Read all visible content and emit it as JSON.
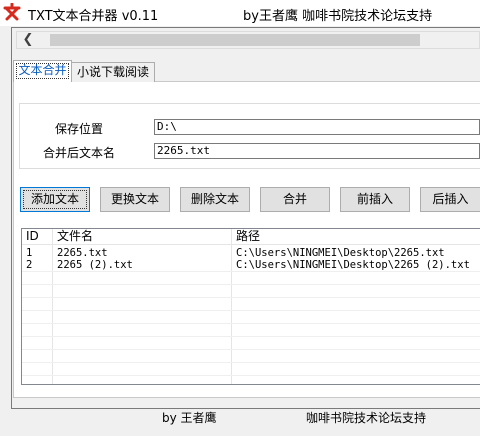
{
  "window": {
    "title": "TXT文本合并器 v0.11",
    "credit": "by王者鹰 咖啡书院技术论坛支持"
  },
  "tabs": [
    {
      "label": "文本合并",
      "active": true
    },
    {
      "label": "小说下载阅读",
      "active": false
    }
  ],
  "form": {
    "save_location_label": "保存位置",
    "save_location_value": "D:\\",
    "merged_name_label": "合并后文本名",
    "merged_name_value": "2265.txt"
  },
  "buttons": {
    "add": "添加文本",
    "replace": "更换文本",
    "delete": "删除文本",
    "merge": "合并",
    "insert_before": "前插入",
    "insert_after": "后插入"
  },
  "file_list": {
    "columns": [
      "ID",
      "文件名",
      "路径"
    ],
    "rows": [
      {
        "id": "1",
        "name": "2265.txt",
        "path": "C:\\Users\\NINGMEI\\Desktop\\2265.txt"
      },
      {
        "id": "2",
        "name": "2265 (2).txt",
        "path": "C:\\Users\\NINGMEI\\Desktop\\2265 (2).txt"
      }
    ]
  },
  "footer": {
    "author": "by 王者鹰",
    "support": "咖啡书院技术论坛支持"
  },
  "colors": {
    "icon_red": "#d42b1e",
    "active_tab_text": "#0a5cc1",
    "default_button_border": "#0078d7"
  },
  "icons": {
    "app": "text-wen-icon",
    "scroll_left": "chevron-left-icon"
  }
}
